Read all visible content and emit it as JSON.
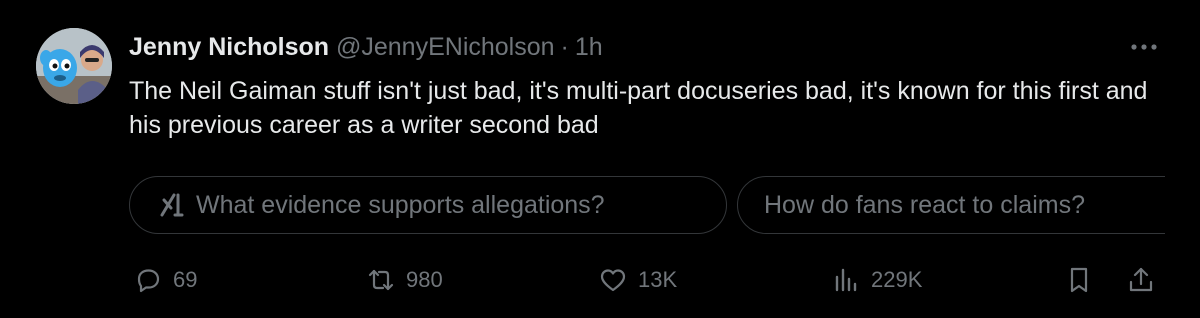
{
  "tweet": {
    "author_name": "Jenny Nicholson",
    "author_handle": "@JennyENicholson",
    "separator": "·",
    "time": "1h",
    "text": "The Neil Gaiman stuff isn't just bad, it's multi-part docuseries bad, it's known for this first and his previous career as a writer second bad"
  },
  "grok_suggestions": [
    {
      "label": "What evidence supports allegations?",
      "icon": "grok-icon"
    },
    {
      "label": "How do fans react to claims?"
    }
  ],
  "actions": {
    "replies": "69",
    "reposts": "980",
    "likes": "13K",
    "views": "229K"
  },
  "icons": [
    "more-icon",
    "reply-icon",
    "repost-icon",
    "like-icon",
    "views-icon",
    "bookmark-icon",
    "share-icon"
  ],
  "colors": {
    "background": "#000000",
    "text": "#e7e9ea",
    "secondary": "#71767b",
    "border": "#333639"
  }
}
